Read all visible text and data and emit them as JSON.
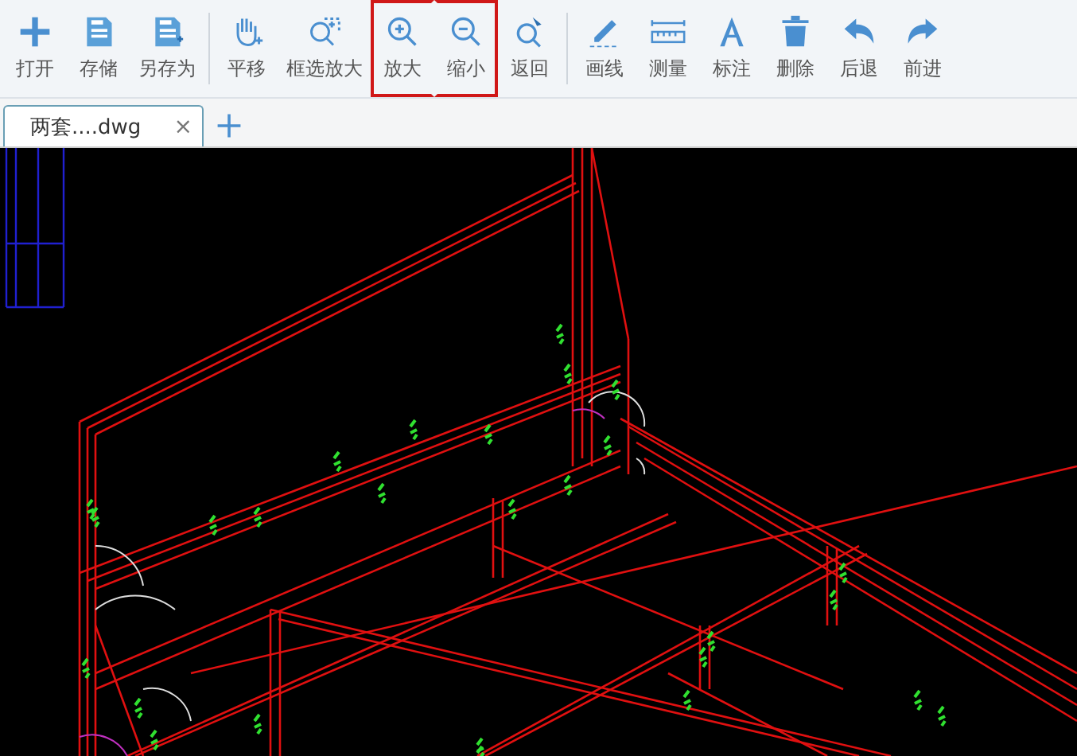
{
  "toolbar": {
    "groups": [
      {
        "tools": [
          {
            "kind": "plus",
            "label": "打开",
            "highlighted": false
          },
          {
            "kind": "save",
            "label": "存储",
            "highlighted": false
          },
          {
            "kind": "saveas",
            "label": "另存为",
            "highlighted": false
          }
        ]
      },
      {
        "tools": [
          {
            "kind": "hand",
            "label": "平移",
            "highlighted": false
          },
          {
            "kind": "zoombox",
            "label": "框选放大",
            "highlighted": false
          },
          {
            "kind": "zoomin",
            "label": "放大",
            "highlighted": true
          },
          {
            "kind": "zoomout",
            "label": "缩小",
            "highlighted": true
          },
          {
            "kind": "back",
            "label": "返回",
            "highlighted": false
          }
        ]
      },
      {
        "tools": [
          {
            "kind": "pencil",
            "label": "画线",
            "highlighted": false
          },
          {
            "kind": "ruler",
            "label": "测量",
            "highlighted": false
          },
          {
            "kind": "text",
            "label": "标注",
            "highlighted": false
          },
          {
            "kind": "trash",
            "label": "删除",
            "highlighted": false
          },
          {
            "kind": "undo",
            "label": "后退",
            "highlighted": false
          },
          {
            "kind": "redo",
            "label": "前进",
            "highlighted": false
          }
        ]
      }
    ]
  },
  "tabs": [
    {
      "label": "两套....dwg",
      "close": "×",
      "selected": true
    }
  ]
}
